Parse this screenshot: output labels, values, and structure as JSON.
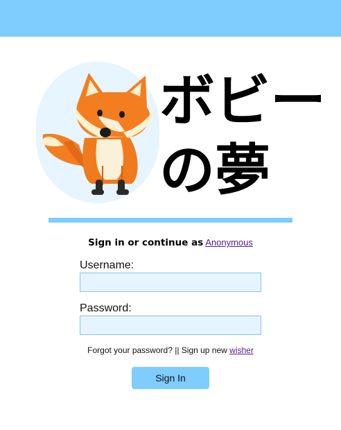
{
  "header": {
    "bar_color": "#7fccff"
  },
  "logo": {
    "icon": "fox-mascot-icon",
    "background_color": "#e6f5ff"
  },
  "title": {
    "line1": "ボビー",
    "line2": "の夢"
  },
  "signin": {
    "heading": "Sign in or continue as",
    "anonymous_link": "Anonymous"
  },
  "form": {
    "username_label": "Username:",
    "username_value": "",
    "password_label": "Password:",
    "password_value": "",
    "forgot_text": "Forgot your password? || Sign up new",
    "wisher_link": "wisher",
    "submit_label": "Sign In"
  },
  "colors": {
    "accent": "#7fccff",
    "input_background": "#e5f4ff",
    "input_border": "#7fc7ef",
    "link": "#551a8b"
  }
}
